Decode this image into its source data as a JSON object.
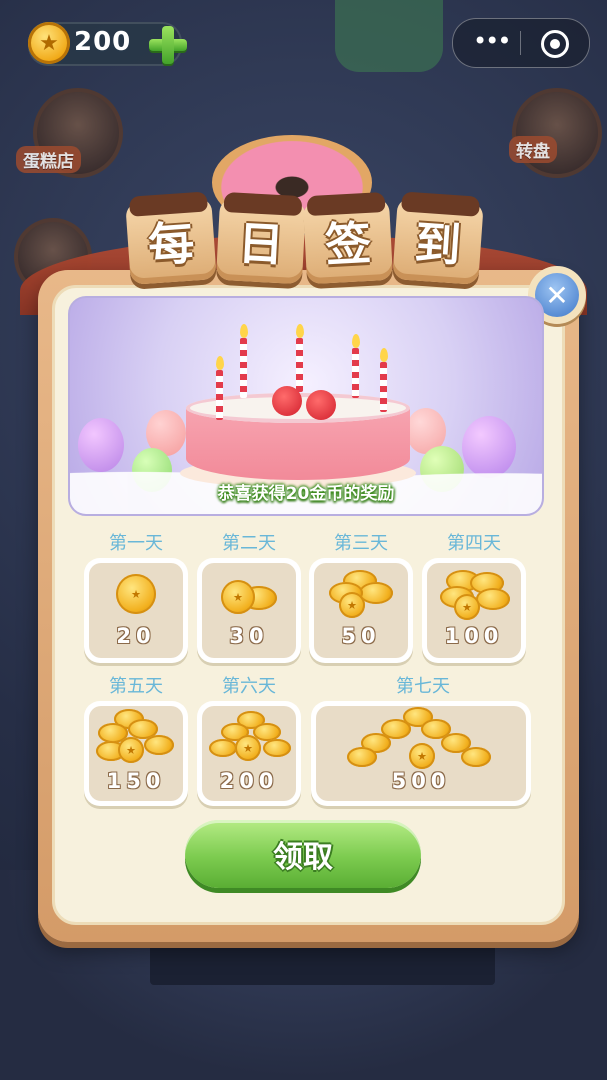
{
  "hud": {
    "coin_count": "200"
  },
  "side_buttons": {
    "left_label": "蛋糕店",
    "right_label": "转盘"
  },
  "modal": {
    "title_chars": [
      "每",
      "日",
      "签",
      "到"
    ],
    "banner_text": "恭喜获得20金币的奖励",
    "days": [
      {
        "label": "第一天",
        "amount": "20"
      },
      {
        "label": "第二天",
        "amount": "30"
      },
      {
        "label": "第三天",
        "amount": "50"
      },
      {
        "label": "第四天",
        "amount": "100"
      },
      {
        "label": "第五天",
        "amount": "150"
      },
      {
        "label": "第六天",
        "amount": "200"
      },
      {
        "label": "第七天",
        "amount": "500"
      }
    ],
    "claim_label": "领取"
  },
  "icons": {
    "close": "close-icon",
    "more": "more-dots-icon",
    "target": "target-icon",
    "add": "plus-icon"
  },
  "colors": {
    "day_label": "#69b7d8",
    "claim_button": "#7ccb4f",
    "panel_frame": "#d49b68"
  }
}
